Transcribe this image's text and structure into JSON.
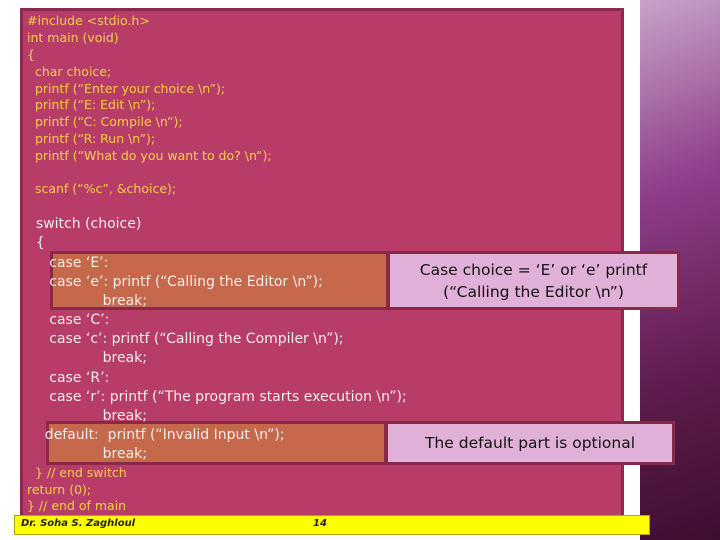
{
  "code_top": [
    "#include <stdio.h>",
    "int main (void)",
    "{",
    "  char choice;",
    "  printf (“Enter your choice \\n”);",
    "  printf (“E: Edit \\n”);",
    "  printf (“C: Compile \\n”);",
    "  printf (“R: Run \\n”);",
    "  printf (“What do you want to do? \\n“);",
    "  scanf (“%c”, &choice);"
  ],
  "code_switch": [
    "  switch (choice)",
    "  {",
    "     case ‘E’:",
    "     case ‘e’: printf (“Calling the Editor \\n”);",
    "                 break;",
    "     case ‘C’:",
    "     case ‘c’: printf (“Calling the Compiler \\n”);",
    "                 break;",
    "     case ‘R’:",
    "     case ‘r’: printf (“The program starts execution \\n”);",
    "                 break;",
    "    default:  printf (“Invalid Input \\n”);",
    "                 break;"
  ],
  "code_bottom": [
    "  } // end switch",
    "return (0);",
    "} // end of main"
  ],
  "callouts": {
    "case_e": "Case choice = ‘E’ or ‘e’ printf (“Calling the Editor \\n”)",
    "default": "The default part is optional"
  },
  "footer": {
    "author": "Dr. Soha S. Zaghloul",
    "page": "14"
  }
}
